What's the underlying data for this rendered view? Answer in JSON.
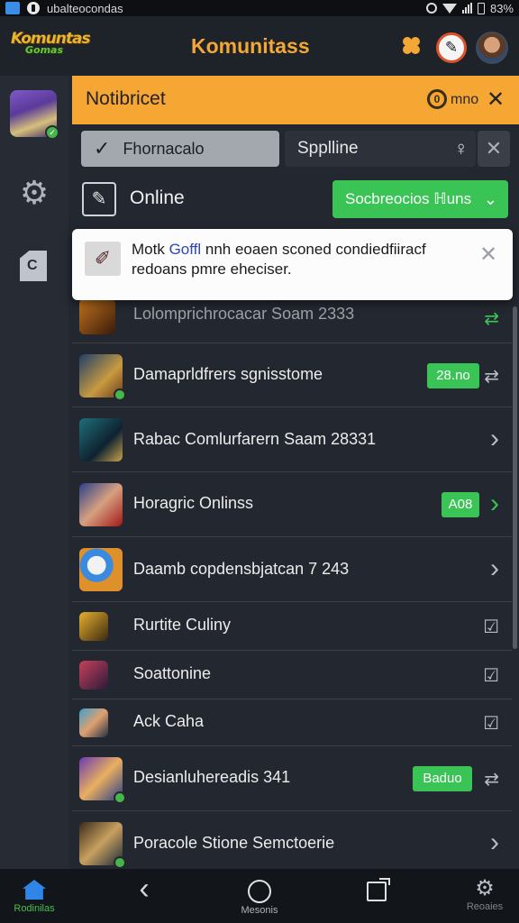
{
  "status_bar": {
    "carrier_text": "ubalteocondas",
    "battery": "83%"
  },
  "header": {
    "logo_line1": "Komuntas",
    "logo_line2": "Gomas",
    "title": "Komunitass",
    "icons": [
      "puzzle-icon",
      "pin-icon",
      "profile-avatar"
    ]
  },
  "rail": {
    "icons": [
      "community-avatar",
      "gear-icon",
      "document-icon"
    ],
    "doc_glyph": "C"
  },
  "notification_bar": {
    "label": "Notibricet",
    "mode_glyph": "0",
    "mode_label": "mno",
    "close_glyph": "✕"
  },
  "filters": {
    "selected_label": "Fhornacalo",
    "check_glyph": "✓",
    "other_label": "Spplline",
    "bulb_glyph": "♀",
    "clear_glyph": "✕"
  },
  "online_row": {
    "edit_glyph": "✎",
    "label": "Online",
    "button_label": "Socbreocios ℍuns",
    "chevron": "⌄"
  },
  "toast": {
    "icon_glyph": "✐",
    "text_before": "Motk ",
    "link_text": "Goffl",
    "text_after": " nnh eoaen sconed condiedfiiracf redoans pmre eheciser.",
    "close_glyph": "✕"
  },
  "list": [
    {
      "name": "Lolomprichrocacar Soam 2333",
      "pill": "",
      "action": "⇄",
      "green": true
    },
    {
      "name": "Damaprldfrers sgnisstome",
      "pill": "28.no",
      "action": "⇄",
      "green": false
    },
    {
      "name": "Rabac Comlurfarern Saam 28331",
      "pill": "",
      "action": "›",
      "green": false
    },
    {
      "name": "Horagric Onlinss",
      "pill": "A08",
      "action": "›",
      "green": true
    },
    {
      "name": "Daamb copdensbjatcan 7 243",
      "pill": "",
      "action": "›",
      "green": false
    },
    {
      "name": "Rurtite Culiny",
      "pill": "",
      "action": "☑",
      "green": false
    },
    {
      "name": "Soattonine",
      "pill": "",
      "action": "☑",
      "green": false
    },
    {
      "name": "Ack Caha",
      "pill": "",
      "action": "☑",
      "green": false
    },
    {
      "name": "Desianluhereadis 341",
      "pill": "Baduo",
      "action": "⇄",
      "green": false
    },
    {
      "name": "Poracole Stione Semctoerie",
      "pill": "",
      "action": "›",
      "green": false
    }
  ],
  "bottom_nav": [
    {
      "label": "Rodinilas",
      "icon": "home-icon"
    },
    {
      "label": "",
      "icon": "back-icon",
      "glyph": "‹"
    },
    {
      "label": "Mesonis",
      "icon": "circle-icon"
    },
    {
      "label": "",
      "icon": "recents-icon"
    },
    {
      "label": "Reoaies",
      "icon": "gear-icon",
      "glyph": "⚙"
    }
  ],
  "colors": {
    "accent_orange": "#f6a632",
    "accent_green": "#3bc456",
    "background": "#23272f",
    "home_blue": "#2f86e8"
  }
}
